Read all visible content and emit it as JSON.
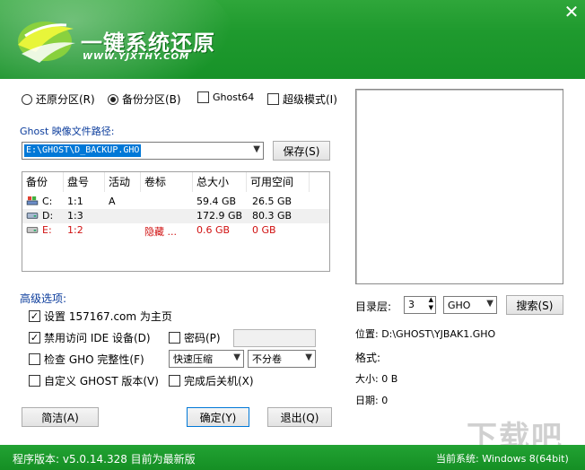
{
  "app": {
    "title": "一键系统还原",
    "subtitle": "WWW.YJXTHY.COM",
    "close_glyph": "✕"
  },
  "modes": {
    "restore_label": "还原分区(R)",
    "backup_label": "备份分区(B)",
    "ghost64_label": "Ghost64",
    "super_label": "超级模式(I)"
  },
  "path": {
    "label": "Ghost 映像文件路径:",
    "value": "E:\\GHOST\\D_BACKUP.GHO",
    "save_button": "保存(S)"
  },
  "partitions": {
    "headers": [
      "备份",
      "盘号",
      "活动",
      "卷标",
      "总大小",
      "可用空间"
    ],
    "rows": [
      {
        "drive": "C:",
        "disk": "1:1",
        "active": "A",
        "label": "",
        "total": "59.4 GB",
        "free": "26.5 GB",
        "hidden": false
      },
      {
        "drive": "D:",
        "disk": "1:3",
        "active": "",
        "label": "",
        "total": "172.9 GB",
        "free": "80.3 GB",
        "hidden": false
      },
      {
        "drive": "E:",
        "disk": "1:2",
        "active": "",
        "label": "隐藏 ...",
        "total": "0.6 GB",
        "free": "0 GB",
        "hidden": true
      }
    ]
  },
  "advanced": {
    "title": "高级选项:",
    "set_homepage": "设置 157167.com 为主页",
    "disable_ide": "禁用访问 IDE 设备(D)",
    "password": "密码(P)",
    "check_gho": "检查 GHO 完整性(F)",
    "compression": "快速压缩",
    "split": "不分卷",
    "custom_ghost": "自定义 GHOST 版本(V)",
    "shutdown": "完成后关机(X)"
  },
  "buttons": {
    "simple": "简洁(A)",
    "ok": "确定(Y)",
    "exit": "退出(Q)"
  },
  "browse": {
    "dir_level_label": "目录层:",
    "dir_level_value": "3",
    "filetype": "GHO",
    "search_button": "搜索(S)"
  },
  "info": {
    "location": "位置: D:\\GHOST\\YJBAK1.GHO",
    "format": "格式:",
    "size": "大小: 0 B",
    "date": "日期: 0"
  },
  "footer": {
    "version": "程序版本: v5.0.14.328  目前为最新版",
    "system": "当前系统: Windows 8(64bit)"
  },
  "watermark": "下载吧"
}
